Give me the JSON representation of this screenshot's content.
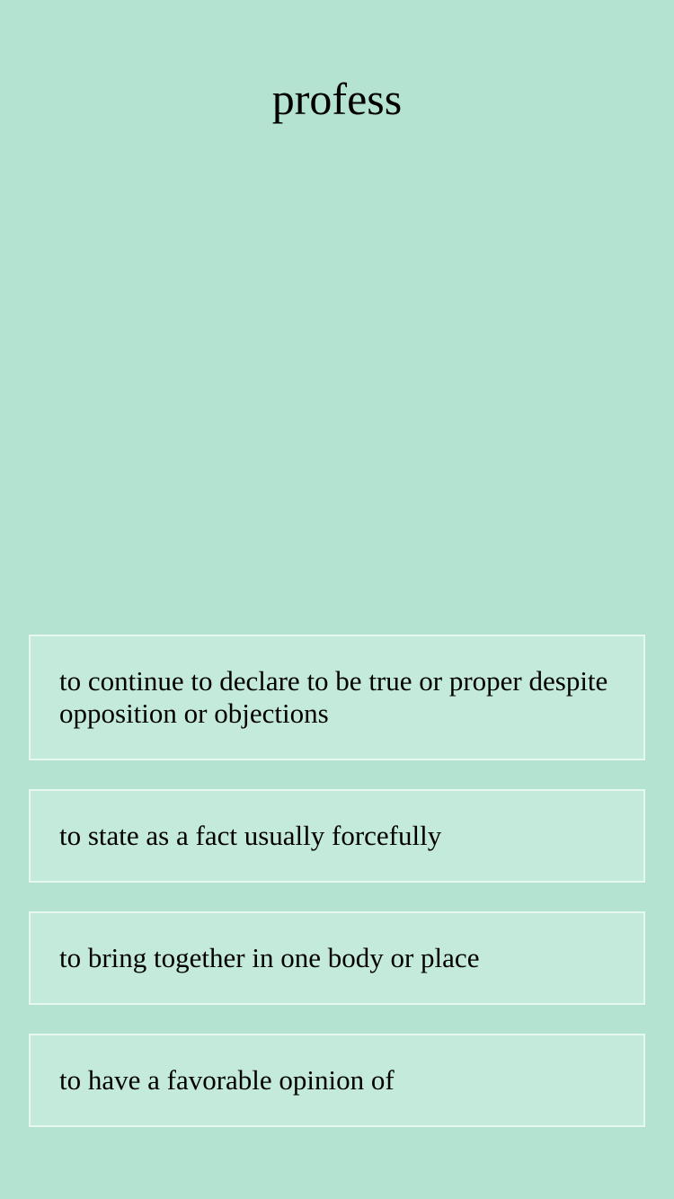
{
  "quiz": {
    "word": "profess",
    "options": [
      {
        "label": "to continue to declare to be true or proper despite opposition or objections"
      },
      {
        "label": "to state as a fact usually forcefully"
      },
      {
        "label": "to bring together in one body or place"
      },
      {
        "label": "to have a favorable opinion of"
      }
    ]
  },
  "colors": {
    "background": "#b5e3d1",
    "option_background": "#c3eada",
    "option_border": "#e6f7ef",
    "text": "#000000"
  }
}
